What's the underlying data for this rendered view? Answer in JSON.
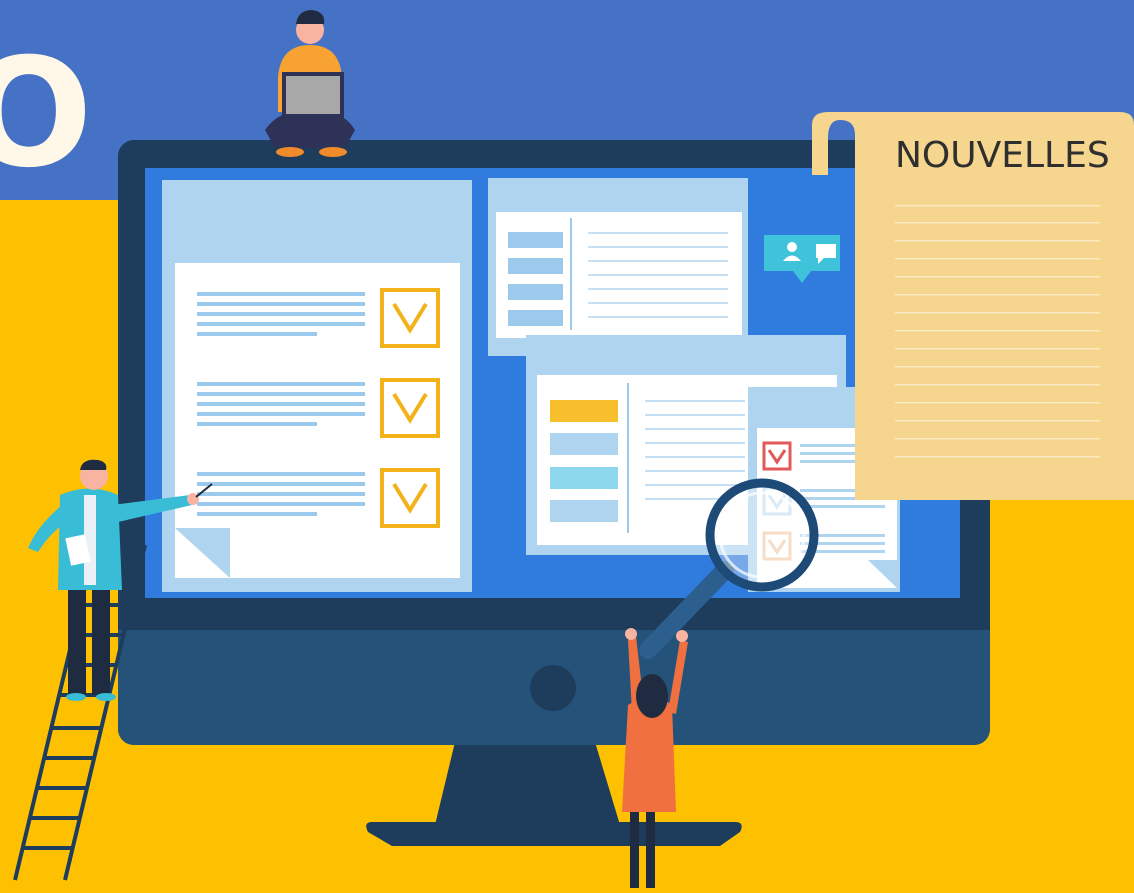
{
  "illustration": {
    "heading_fragment": "O",
    "news_panel": {
      "title": "NOUVELLES"
    }
  },
  "colors": {
    "banner_blue": "#4672C6",
    "background_yellow": "#FDC101",
    "monitor_frame": "#1E3D5C",
    "screen_blue": "#2F7BDE",
    "panel_light": "#AED4F0",
    "check_yellow": "#F3B21A",
    "check_red": "#E05A5A",
    "accent_cyan": "#3EC3DA",
    "scroll_paper": "#F6D58E",
    "woman_dress": "#F07040",
    "man_jacket": "#39BDD6"
  },
  "icons": [
    "user-icon",
    "chat-bubble-icon",
    "magnifying-glass-icon",
    "checkbox-check-icon",
    "ladder-icon",
    "laptop-icon",
    "pointer-stick-icon"
  ]
}
